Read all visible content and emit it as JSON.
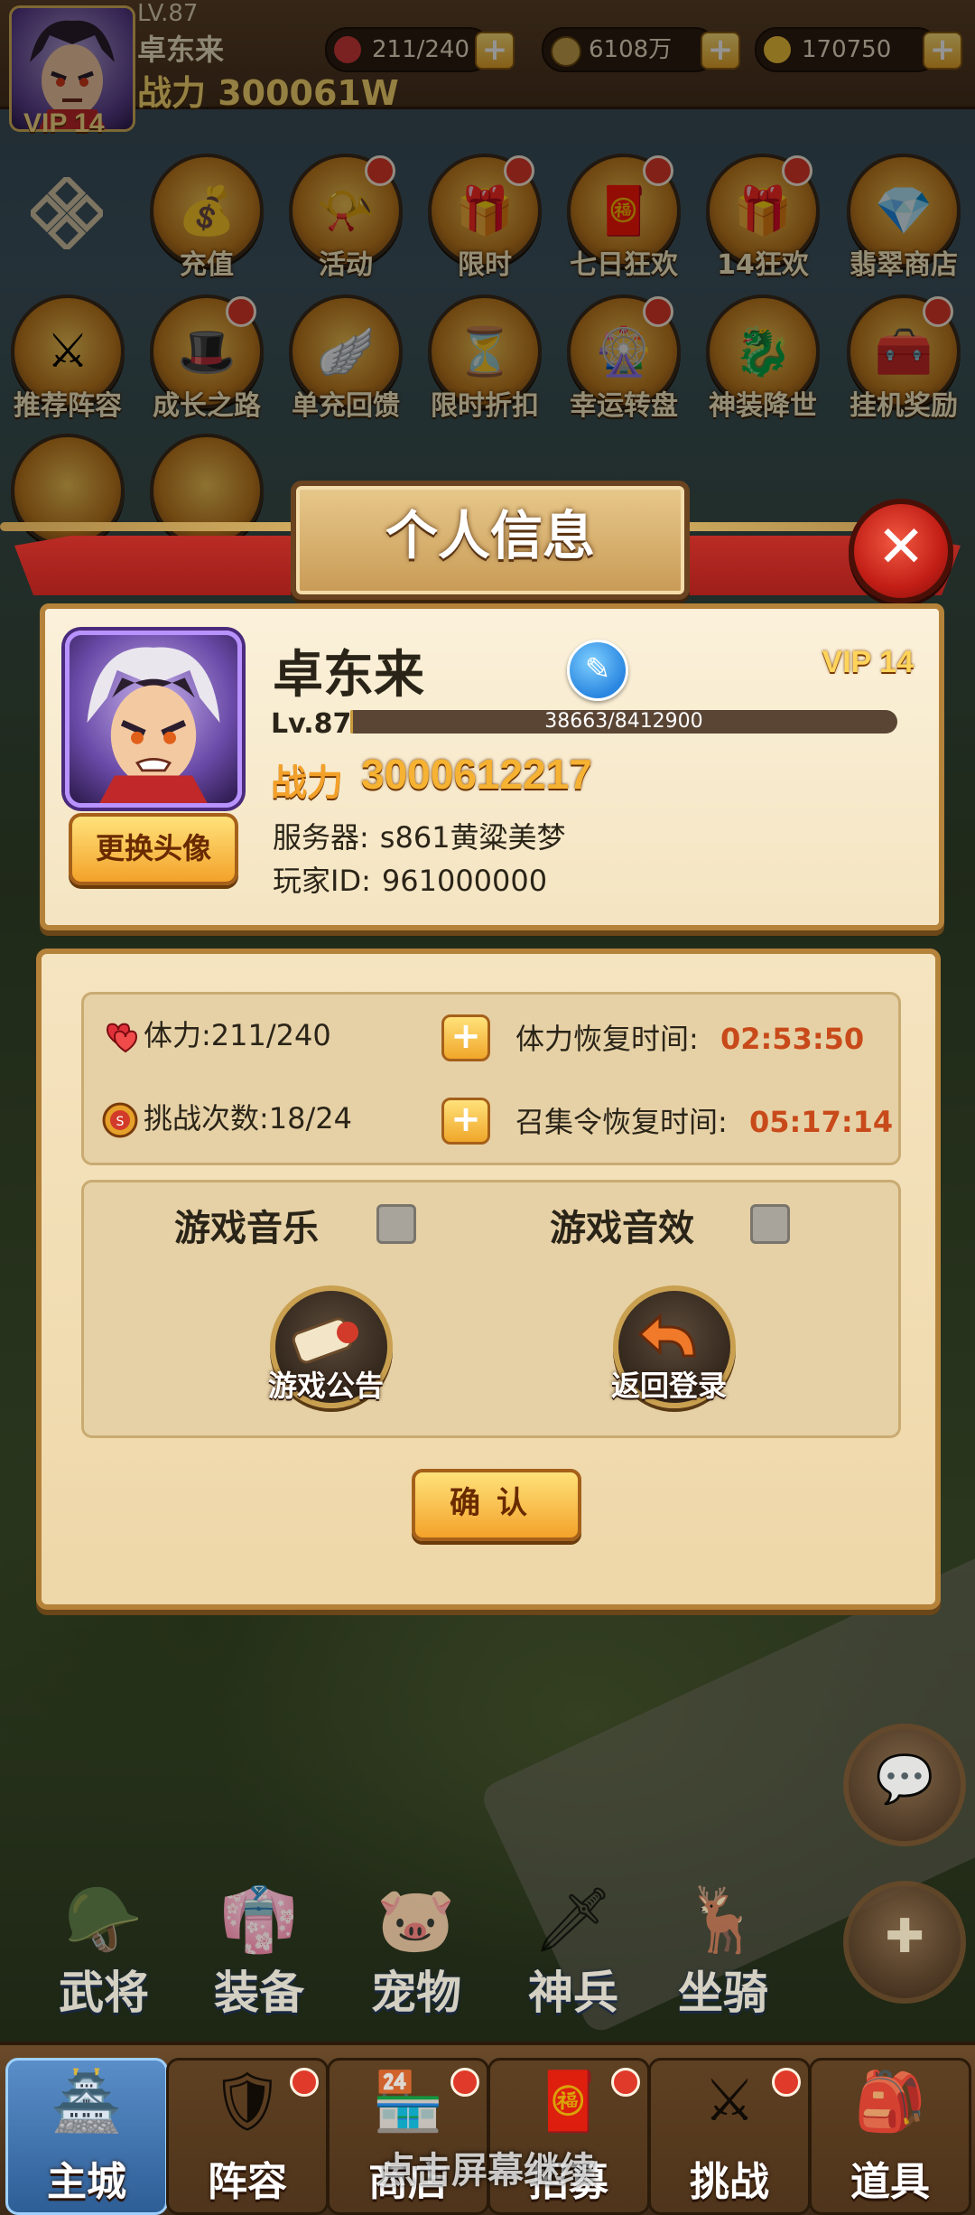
{
  "topbar": {
    "level": "LV.87",
    "name": "卓东来",
    "power": "战力 300061W",
    "vip": "VIP 14",
    "stamina": "211/240",
    "coins": "6108万",
    "ingots": "170750"
  },
  "activities": [
    {
      "label": "充值",
      "icon": "gold-ingots-icon",
      "glyph": "💰",
      "badge": false
    },
    {
      "label": "活动",
      "icon": "horn-icon",
      "glyph": "📯",
      "badge": true
    },
    {
      "label": "限时",
      "icon": "treasure-chest-icon",
      "glyph": "🎁",
      "badge": true
    },
    {
      "label": "七日狂欢",
      "icon": "red-envelope-icon",
      "glyph": "🧧",
      "badge": true
    },
    {
      "label": "14狂欢",
      "icon": "gift-box-icon",
      "glyph": "🎁",
      "badge": true
    },
    {
      "label": "翡翠商店",
      "icon": "jade-shop-icon",
      "glyph": "💎",
      "badge": false
    },
    {
      "label": "推荐阵容",
      "icon": "crossed-swords-icon",
      "glyph": "⚔",
      "badge": false
    },
    {
      "label": "成长之路",
      "icon": "growth-hat-icon",
      "glyph": "🎩",
      "badge": true
    },
    {
      "label": "单充回馈",
      "icon": "wings-icon",
      "glyph": "🪽",
      "badge": false
    },
    {
      "label": "限时折扣",
      "icon": "hourglass-icon",
      "glyph": "⏳",
      "badge": false
    },
    {
      "label": "幸运转盘",
      "icon": "wheel-icon",
      "glyph": "🎡",
      "badge": true
    },
    {
      "label": "神装降世",
      "icon": "dragon-icon",
      "glyph": "🐉",
      "badge": false
    },
    {
      "label": "挂机奖励",
      "icon": "reward-chest-icon",
      "glyph": "🧰",
      "badge": true
    }
  ],
  "modal": {
    "title": "个人信息",
    "player": {
      "name": "卓东来",
      "vip": "VIP 14",
      "level": "Lv.87",
      "xp_text": "38663/8412900",
      "xp_fraction": 0.0046,
      "power_label": "战力",
      "power_value": "3000612217",
      "server_label": "服务器:",
      "server_value": "s861黄粱美梦",
      "id_label": "玩家ID:",
      "id_value": "961000000"
    },
    "change_avatar_label": "更换头像",
    "stats": {
      "stamina_label": "体力:",
      "stamina_value": "211/240",
      "stamina_recover_label": "体力恢复时间:",
      "stamina_recover_time": "02:53:50",
      "challenge_label": "挑战次数:",
      "challenge_value": "18/24",
      "summon_recover_label": "召集令恢复时间:",
      "summon_recover_time": "05:17:14"
    },
    "settings": {
      "music_label": "游戏音乐",
      "music_on": false,
      "sfx_label": "游戏音效",
      "sfx_on": false,
      "notice_label": "游戏公告",
      "logout_label": "返回登录"
    },
    "confirm_label": "确认"
  },
  "features": [
    "武将",
    "装备",
    "宠物",
    "神兵",
    "坐骑"
  ],
  "navbar": [
    {
      "label": "主城",
      "active": true,
      "badge": false
    },
    {
      "label": "阵容",
      "active": false,
      "badge": true
    },
    {
      "label": "商店",
      "active": false,
      "badge": true
    },
    {
      "label": "招募",
      "active": false,
      "badge": true
    },
    {
      "label": "挑战",
      "active": false,
      "badge": true
    },
    {
      "label": "道具",
      "active": false,
      "badge": false
    }
  ],
  "continue_text": "点击屏幕继续"
}
